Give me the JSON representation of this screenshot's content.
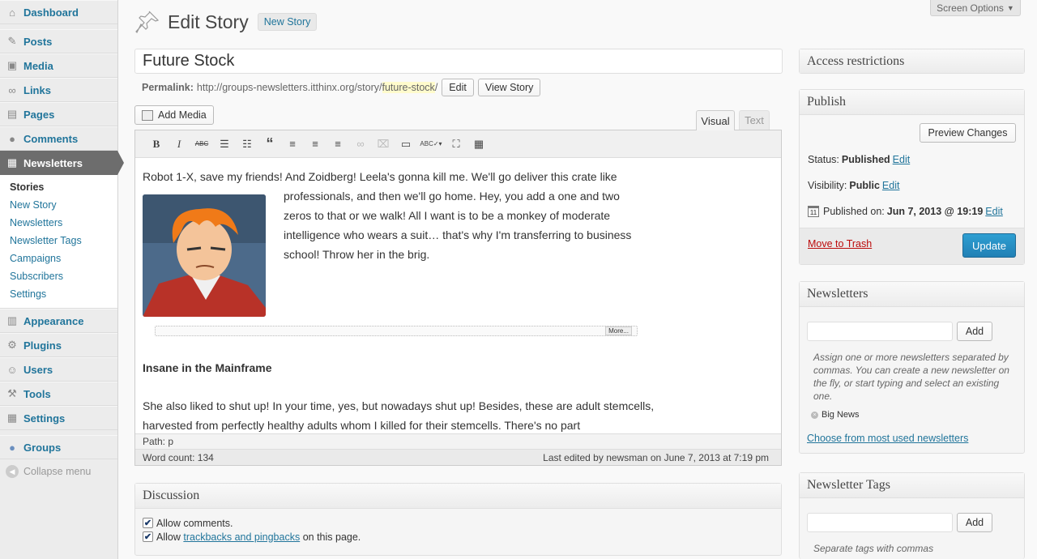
{
  "sidebar": {
    "items_top": [
      {
        "label": "Dashboard",
        "icon": "dashboard-icon"
      },
      {
        "label": "Posts",
        "icon": "pin-icon"
      },
      {
        "label": "Media",
        "icon": "media-icon"
      },
      {
        "label": "Links",
        "icon": "link-icon"
      },
      {
        "label": "Pages",
        "icon": "pages-icon"
      },
      {
        "label": "Comments",
        "icon": "comments-icon"
      }
    ],
    "active": {
      "label": "Newsletters",
      "icon": "newsletters-icon"
    },
    "submenu": [
      "Stories",
      "New Story",
      "Newsletters",
      "Newsletter Tags",
      "Campaigns",
      "Subscribers",
      "Settings"
    ],
    "items_bottom": [
      {
        "label": "Appearance",
        "icon": "appearance-icon"
      },
      {
        "label": "Plugins",
        "icon": "plugins-icon"
      },
      {
        "label": "Users",
        "icon": "users-icon"
      },
      {
        "label": "Tools",
        "icon": "tools-icon"
      },
      {
        "label": "Settings",
        "icon": "settings-icon"
      }
    ],
    "groups": {
      "label": "Groups",
      "icon": "groups-icon"
    },
    "collapse": "Collapse menu"
  },
  "screen_options": "Screen Options",
  "header": {
    "title": "Edit Story",
    "add_new": "New Story"
  },
  "post": {
    "title": "Future Stock",
    "permalink_label": "Permalink:",
    "permalink_base": "http://groups-newsletters.itthinx.org/story/",
    "permalink_slug": "future-stock",
    "permalink_trail": "/",
    "edit_button": "Edit",
    "view_button": "View Story"
  },
  "editor": {
    "add_media": "Add Media",
    "tab_visual": "Visual",
    "tab_text": "Text",
    "para1_first": "Robot 1-X, save my friends! And Zoidberg! Leela's gonna kill me. We'll go deliver this crate like",
    "para1_float": "professionals, and then we'll go home. Hey, you add a one and two zeros to that or we walk! All I want is to be a monkey of moderate intelligence who wears a suit… that's why I'm transferring to business school! Throw her in the brig.",
    "more_label": "More...",
    "heading": "Insane in the Mainframe",
    "para2": "She also liked to shut up! In your time, yes, but nowadays shut up! Besides, these are adult stemcells, harvested from perfectly healthy adults whom I killed for their stemcells. There's no part",
    "path": "Path: p",
    "word_count": "Word count: 134",
    "last_edited": "Last edited by newsman on June 7, 2013 at 7:19 pm"
  },
  "discussion": {
    "title": "Discussion",
    "allow_comments": "Allow comments.",
    "allow_prefix": "Allow",
    "trackbacks_link": "trackbacks and pingbacks",
    "allow_suffix": "on this page."
  },
  "access": {
    "title": "Access restrictions"
  },
  "publish": {
    "title": "Publish",
    "preview": "Preview Changes",
    "status_label": "Status:",
    "status_value": "Published",
    "visibility_label": "Visibility:",
    "visibility_value": "Public",
    "published_label": "Published on:",
    "published_value": "Jun 7, 2013 @ 19:19",
    "edit": "Edit",
    "trash": "Move to Trash",
    "update": "Update"
  },
  "newsletters_box": {
    "title": "Newsletters",
    "add": "Add",
    "help": "Assign one or more newsletters separated by commas. You can create a new newsletter on the fly, or start typing and select an existing one.",
    "tag": "Big News",
    "choose": "Choose from most used newsletters"
  },
  "tags_box": {
    "title": "Newsletter Tags",
    "add": "Add",
    "help": "Separate tags with commas"
  },
  "colors": {
    "link": "#21759b",
    "active_menu": "#6d6d6d",
    "update_button": "#2a8bc0",
    "trash": "#bc0b0b"
  }
}
